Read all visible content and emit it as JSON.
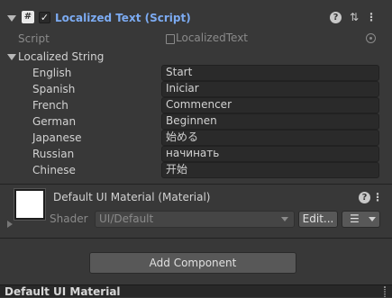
{
  "component": {
    "title": "Localized Text (Script)",
    "enabled": "✓",
    "script_label": "Script",
    "script_value": "LocalizedText"
  },
  "localized_string": {
    "label": "Localized String",
    "entries": [
      {
        "lang": "English",
        "value": "Start"
      },
      {
        "lang": "Spanish",
        "value": "Iniciar"
      },
      {
        "lang": "French",
        "value": "Commencer"
      },
      {
        "lang": "German",
        "value": "Beginnen"
      },
      {
        "lang": "Japanese",
        "value": "始める"
      },
      {
        "lang": "Russian",
        "value": "начинать"
      },
      {
        "lang": "Chinese",
        "value": "开始"
      }
    ]
  },
  "material": {
    "title": "Default UI Material (Material)",
    "shader_label": "Shader",
    "shader_value": "UI/Default",
    "edit_label": "Edit..."
  },
  "add_component_label": "Add Component",
  "bottom_label": "Default UI Material",
  "icons": {
    "script": "#",
    "help": "?",
    "presets": "⇅",
    "more": "⋮",
    "list": "☰"
  }
}
